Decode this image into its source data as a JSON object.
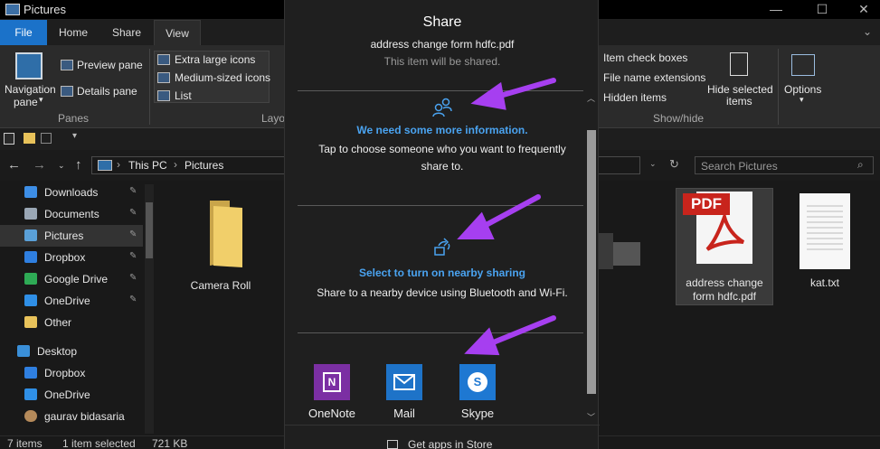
{
  "window": {
    "title": "Pictures",
    "min": "—",
    "max": "☐",
    "close": "✕"
  },
  "ribbon": {
    "tabs": [
      "File",
      "Home",
      "Share",
      "View"
    ],
    "nav_pane": "Navigation",
    "nav_pane2": "pane",
    "preview_pane": "Preview pane",
    "details_pane": "Details pane",
    "panes_group": "Panes",
    "layout_items": [
      "Extra large icons",
      "Medium-sized icons",
      "List"
    ],
    "layout_group": "Layou",
    "show_items": [
      "Item check boxes",
      "File name extensions",
      "Hidden items"
    ],
    "hide_selected": "Hide selected",
    "hide_selected2": "items",
    "options": "Options",
    "showhide_group": "Show/hide",
    "dropdown": "▾"
  },
  "address": {
    "crumbs": [
      "This PC",
      "Pictures"
    ],
    "sep": "›",
    "search_placeholder": "Search Pictures"
  },
  "sidebar": {
    "items": [
      {
        "label": "Downloads",
        "color": "#3d8ee6"
      },
      {
        "label": "Documents",
        "color": "#9aa7b5"
      },
      {
        "label": "Pictures",
        "color": "#5aa0d8"
      },
      {
        "label": "Dropbox",
        "color": "#2f7fe0"
      },
      {
        "label": "Google Drive",
        "color": "#2eaa55"
      },
      {
        "label": "OneDrive",
        "color": "#2f8fe6"
      },
      {
        "label": "Other",
        "color": "#e8c25a"
      },
      {
        "label": "Desktop",
        "color": "#3a8fd8"
      },
      {
        "label": "Dropbox",
        "color": "#2f7fe0"
      },
      {
        "label": "OneDrive",
        "color": "#2f8fe6"
      },
      {
        "label": "gaurav bidasaria",
        "color": "#b58a5a"
      }
    ]
  },
  "files": [
    {
      "name": "Camera Roll"
    },
    {
      "name": "address change form hdfc.pdf",
      "line1": "address change",
      "line2": "form hdfc.pdf",
      "badge": "PDF"
    },
    {
      "name": "kat.txt"
    }
  ],
  "status": {
    "count": "7 items",
    "selected": "1 item selected",
    "size": "721 KB"
  },
  "share": {
    "title": "Share",
    "filename": "address change form hdfc.pdf",
    "subtitle": "This item will be shared.",
    "info_heading": "We need some more information.",
    "info_body_1": "Tap to choose someone who you want to frequently",
    "info_body_2": "share to.",
    "nearby_heading": "Select to turn on nearby sharing",
    "nearby_body": "Share to a nearby device using Bluetooth and Wi-Fi.",
    "apps": [
      {
        "label": "OneNote",
        "color": "#7b2fa3"
      },
      {
        "label": "Mail",
        "color": "#1e73c8"
      },
      {
        "label": "Skype",
        "color": "#1e78d2"
      }
    ],
    "store_link": "Get apps in Store",
    "accent": "#4aa3f0",
    "arrow_color": "#a63ff0"
  }
}
